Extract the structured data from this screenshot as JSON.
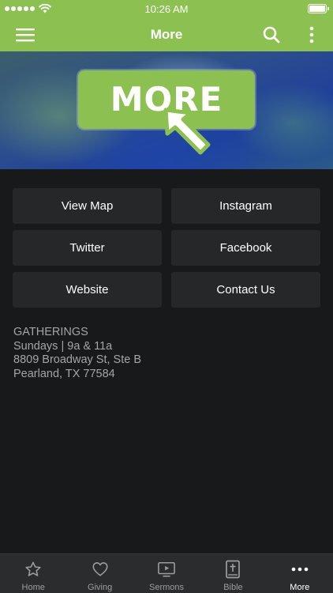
{
  "status_bar": {
    "time": "10:26 AM",
    "battery_level": 1.0
  },
  "nav": {
    "title": "More",
    "icons": [
      "hamburger-menu-icon",
      "search-icon",
      "more-vertical-icon"
    ]
  },
  "hero": {
    "sign_text": "MORE",
    "icon": "cursor-arrow-icon"
  },
  "buttons": [
    {
      "id": "view-map",
      "label": "View Map"
    },
    {
      "id": "instagram",
      "label": "Instagram"
    },
    {
      "id": "twitter",
      "label": "Twitter"
    },
    {
      "id": "facebook",
      "label": "Facebook"
    },
    {
      "id": "website",
      "label": "Website"
    },
    {
      "id": "contact-us",
      "label": "Contact Us"
    }
  ],
  "info": {
    "heading": "GATHERINGS",
    "times": "Sundays | 9a & 11a",
    "address_line1": "8809 Broadway St, Ste B",
    "address_line2": "Pearland, TX 77584"
  },
  "tabs": [
    {
      "id": "home",
      "label": "Home",
      "icon": "star-icon",
      "active": false
    },
    {
      "id": "giving",
      "label": "Giving",
      "icon": "heart-icon",
      "active": false
    },
    {
      "id": "sermons",
      "label": "Sermons",
      "icon": "video-play-icon",
      "active": false
    },
    {
      "id": "bible",
      "label": "Bible",
      "icon": "bible-icon",
      "active": false
    },
    {
      "id": "more",
      "label": "More",
      "icon": "more-dots-icon",
      "active": true
    }
  ],
  "colors": {
    "brand_green": "#8cc152",
    "background": "#18191b",
    "tile": "#262729",
    "tab_bar": "#2b2c2e",
    "info_text": "#a4a5a7"
  }
}
